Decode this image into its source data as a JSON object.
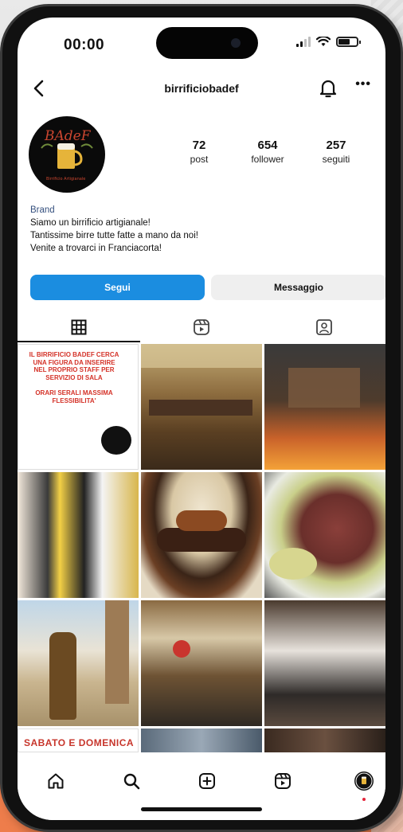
{
  "status_bar": {
    "time": "00:00"
  },
  "header": {
    "username": "birrificiobadef"
  },
  "profile": {
    "stats": [
      {
        "value": "72",
        "label": "post"
      },
      {
        "value": "654",
        "label": "follower"
      },
      {
        "value": "257",
        "label": "seguiti"
      }
    ],
    "category": "Brand",
    "bio_lines": [
      "Siamo un birrificio artigianale!",
      "Tantissime birre tutte fatte a mano da noi!",
      "Venite a trovarci in Franciacorta!"
    ]
  },
  "actions": {
    "follow_label": "Segui",
    "message_label": "Messaggio"
  },
  "tabs": [
    {
      "icon": "grid-icon",
      "active": true
    },
    {
      "icon": "reels-icon",
      "active": false
    },
    {
      "icon": "tagged-icon",
      "active": false
    }
  ],
  "posts": {
    "first_post_text": "IL BIRRIFICIO BADEF CERCA UNA FIGURA DA INSERIRE NEL PROPRIO STAFF PER SERVIZIO DI SALA",
    "first_post_text2": "ORARI SERALI MASSIMA FLESSIBILITA'",
    "last_row_text": "SABATO E DOMENICA"
  },
  "bottom_nav": [
    {
      "icon": "home-icon"
    },
    {
      "icon": "search-icon"
    },
    {
      "icon": "create-icon"
    },
    {
      "icon": "reels-icon"
    },
    {
      "icon": "profile-icon"
    }
  ],
  "colors": {
    "follow_button": "#1b8de0",
    "message_button": "#efefef",
    "background_accent": "#ee7d4b",
    "category_text": "#35507e",
    "notification_dot": "#e4243a"
  }
}
